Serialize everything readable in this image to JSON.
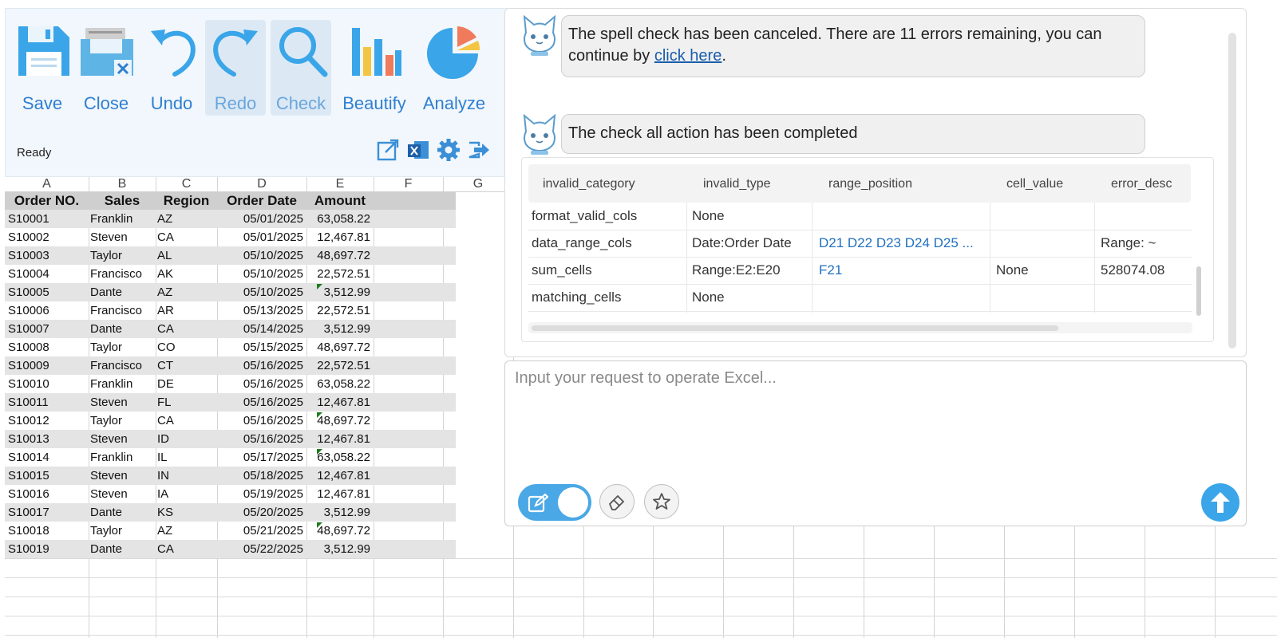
{
  "toolbar": {
    "buttons": [
      {
        "label": "Save",
        "icon": "floppy-disk-icon"
      },
      {
        "label": "Close",
        "icon": "close-file-icon"
      },
      {
        "label": "Undo",
        "icon": "undo-icon"
      },
      {
        "label": "Redo",
        "icon": "redo-icon"
      },
      {
        "label": "Check",
        "icon": "magnifier-icon"
      },
      {
        "label": "Beautify",
        "icon": "bar-chart-icon"
      },
      {
        "label": "Analyze",
        "icon": "pie-chart-icon"
      }
    ],
    "status": "Ready",
    "small_icons": [
      "open-external-icon",
      "excel-icon",
      "settings-gear-icon",
      "exit-icon"
    ]
  },
  "sheet": {
    "columns": [
      "A",
      "B",
      "C",
      "D",
      "E",
      "F",
      "G"
    ],
    "header": [
      "Order NO.",
      "Sales",
      "Region",
      "Order Date",
      "Amount"
    ],
    "rows": [
      {
        "order": "S10001",
        "sales": "Franklin",
        "region": "AZ",
        "date": "05/01/2025",
        "amount": "63,058.22",
        "flag": false
      },
      {
        "order": "S10002",
        "sales": "Steven",
        "region": "CA",
        "date": "05/01/2025",
        "amount": "12,467.81",
        "flag": false
      },
      {
        "order": "S10003",
        "sales": "Taylor",
        "region": "AL",
        "date": "05/10/2025",
        "amount": "48,697.72",
        "flag": false
      },
      {
        "order": "S10004",
        "sales": "Francisco",
        "region": "AK",
        "date": "05/10/2025",
        "amount": "22,572.51",
        "flag": false
      },
      {
        "order": "S10005",
        "sales": "Dante",
        "region": "AZ",
        "date": "05/10/2025",
        "amount": "3,512.99",
        "flag": true
      },
      {
        "order": "S10006",
        "sales": "Francisco",
        "region": "AR",
        "date": "05/13/2025",
        "amount": "22,572.51",
        "flag": false
      },
      {
        "order": "S10007",
        "sales": "Dante",
        "region": "CA",
        "date": "05/14/2025",
        "amount": "3,512.99",
        "flag": false
      },
      {
        "order": "S10008",
        "sales": "Taylor",
        "region": "CO",
        "date": "05/15/2025",
        "amount": "48,697.72",
        "flag": false
      },
      {
        "order": "S10009",
        "sales": "Francisco",
        "region": "CT",
        "date": "05/16/2025",
        "amount": "22,572.51",
        "flag": false
      },
      {
        "order": "S10010",
        "sales": "Franklin",
        "region": "DE",
        "date": "05/16/2025",
        "amount": "63,058.22",
        "flag": false
      },
      {
        "order": "S10011",
        "sales": "Steven",
        "region": "FL",
        "date": "05/16/2025",
        "amount": "12,467.81",
        "flag": false
      },
      {
        "order": "S10012",
        "sales": "Taylor",
        "region": "CA",
        "date": "05/16/2025",
        "amount": "48,697.72",
        "flag": true
      },
      {
        "order": "S10013",
        "sales": "Steven",
        "region": "ID",
        "date": "05/16/2025",
        "amount": "12,467.81",
        "flag": false
      },
      {
        "order": "S10014",
        "sales": "Franklin",
        "region": "IL",
        "date": "05/17/2025",
        "amount": "63,058.22",
        "flag": true
      },
      {
        "order": "S10015",
        "sales": "Steven",
        "region": "IN",
        "date": "05/18/2025",
        "amount": "12,467.81",
        "flag": false
      },
      {
        "order": "S10016",
        "sales": "Steven",
        "region": "IA",
        "date": "05/19/2025",
        "amount": "12,467.81",
        "flag": false
      },
      {
        "order": "S10017",
        "sales": "Dante",
        "region": "KS",
        "date": "05/20/2025",
        "amount": "3,512.99",
        "flag": false
      },
      {
        "order": "S10018",
        "sales": "Taylor",
        "region": "AZ",
        "date": "05/21/2025",
        "amount": "48,697.72",
        "flag": true
      },
      {
        "order": "S10019",
        "sales": "Dante",
        "region": "CA",
        "date": "05/22/2025",
        "amount": "3,512.99",
        "flag": false
      }
    ]
  },
  "chat": {
    "messages": [
      {
        "text_before": "The spell check has been canceled. There are 11 errors remaining, you can continue by ",
        "link": "click here",
        "text_after": "."
      },
      {
        "text": "The check all action has been completed"
      }
    ],
    "result_table": {
      "headers": [
        "invalid_category",
        "invalid_type",
        "range_position",
        "cell_value",
        "error_desc"
      ],
      "rows": [
        [
          "format_valid_cols",
          "None",
          "",
          "",
          ""
        ],
        [
          "data_range_cols",
          "Date:Order Date",
          "D21 D22 D23 D24 D25 ...",
          "",
          "Range:  ~"
        ],
        [
          "sum_cells",
          "Range:E2:E20",
          "F21",
          "None",
          "528074.08"
        ],
        [
          "matching_cells",
          "None",
          "",
          "",
          ""
        ]
      ]
    }
  },
  "input": {
    "placeholder": "Input your request to operate Excel...",
    "buttons": [
      "edit-mode-toggle",
      "eraser-icon",
      "star-icon",
      "send-arrow-icon"
    ]
  },
  "colors": {
    "accent": "#3aa5e8",
    "toolbar_text": "#2f7fd0",
    "link": "#1f70c1",
    "band": "#e4e4e4"
  }
}
